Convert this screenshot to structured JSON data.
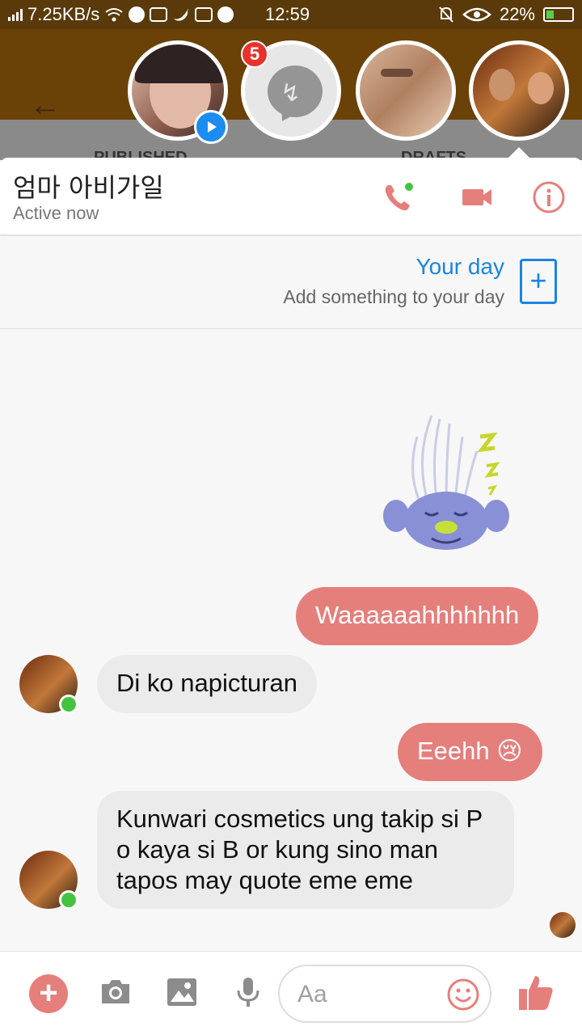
{
  "status_bar": {
    "net_speed": "7.25KB/s",
    "time": "12:59",
    "battery": "22%",
    "battery_level": 0.22
  },
  "underlying_app": {
    "tab_published": "PUBLISHED",
    "tab_drafts": "DRAFTS"
  },
  "chat_heads": {
    "unread_badge": "5"
  },
  "chat": {
    "contact_name": "엄마 아비가일",
    "contact_status": "Active now"
  },
  "your_day": {
    "title": "Your day",
    "subtitle": "Add something to your day"
  },
  "messages": [
    {
      "direction": "out",
      "text": "Waaaaaahhhhhhh"
    },
    {
      "direction": "in",
      "text": "Di ko napicturan"
    },
    {
      "direction": "out",
      "text": "Eeehh 😢"
    },
    {
      "direction": "in",
      "text": "Kunwari cosmetics ung takip si P o kaya si B or kung sino man tapos may quote eme eme"
    }
  ],
  "composer": {
    "placeholder": "Aa"
  },
  "colors": {
    "accent": "#e57f7c",
    "link_blue": "#1b84e0",
    "online_green": "#45c23f",
    "header_brown": "#6a4208"
  },
  "icons": [
    "back-arrow-icon",
    "phone-icon",
    "video-camera-icon",
    "info-icon",
    "plus-icon",
    "camera-icon",
    "image-icon",
    "microphone-icon",
    "emoji-icon",
    "thumbs-up-icon"
  ]
}
